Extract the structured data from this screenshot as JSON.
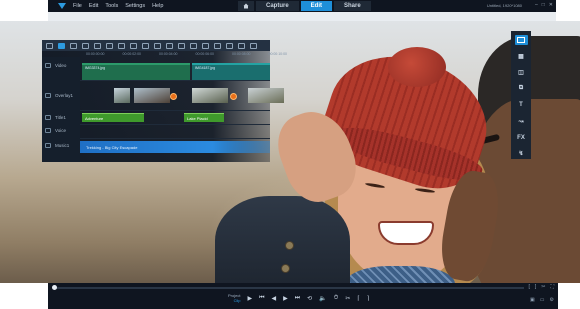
{
  "menubar": {
    "items": [
      "File",
      "Edit",
      "Tools",
      "Settings",
      "Help"
    ],
    "tabs": [
      {
        "label": "",
        "icon": "home-icon"
      },
      {
        "label": "Capture"
      },
      {
        "label": "Edit"
      },
      {
        "label": "Share"
      }
    ],
    "active_tab": "Edit",
    "project_status": "Untitled, 1920*1080",
    "window_controls": [
      "minimize-icon",
      "maximize-icon",
      "close-icon"
    ]
  },
  "timeline": {
    "ruler": [
      "00:00:00:00",
      "00:00:02:00",
      "00:00:04:00",
      "00:00:06:00",
      "00:00:08:00",
      "00:00:10:00"
    ],
    "tracks": [
      {
        "label": "Video",
        "icon": "video-track-icon"
      },
      {
        "label": "Overlay1",
        "icon": "overlay-track-icon"
      },
      {
        "label": "Title1",
        "icon": "title-track-icon"
      },
      {
        "label": "Voice",
        "icon": "voice-track-icon"
      },
      {
        "label": "Music1",
        "icon": "music-track-icon"
      }
    ],
    "video_clips": [
      "IMG3374.jpg",
      "IMG4187.jpg"
    ],
    "title_clips": [
      "Adventure",
      "Lake Placid"
    ],
    "music_clip": "Trekking - Big City Escapade"
  },
  "right_tools": [
    {
      "icon": "media-icon",
      "label": ""
    },
    {
      "icon": "instant-project-icon",
      "label": ""
    },
    {
      "icon": "graphics-icon",
      "label": ""
    },
    {
      "icon": "transition-icon",
      "label": ""
    },
    {
      "icon": "title-icon",
      "label": "T"
    },
    {
      "icon": "path-icon",
      "label": ""
    },
    {
      "icon": "filter-icon",
      "label": "FX"
    },
    {
      "icon": "motion-icon",
      "label": ""
    }
  ],
  "player": {
    "mode_project": "Project",
    "mode_clip": "Clip",
    "controls": [
      "play-icon",
      "go-to-start-icon",
      "previous-frame-icon",
      "next-frame-icon",
      "go-to-end-icon",
      "repeat-icon",
      "volume-icon",
      "timecode-icon",
      "split-icon",
      "mark-in-icon",
      "mark-out-icon"
    ],
    "timecode": "00:00:00:00",
    "colors": {
      "accent": "#1e8fd9",
      "panel": "#0f1520",
      "title_clip": "#3f9a2c",
      "music_clip": "#2b8be0"
    }
  }
}
